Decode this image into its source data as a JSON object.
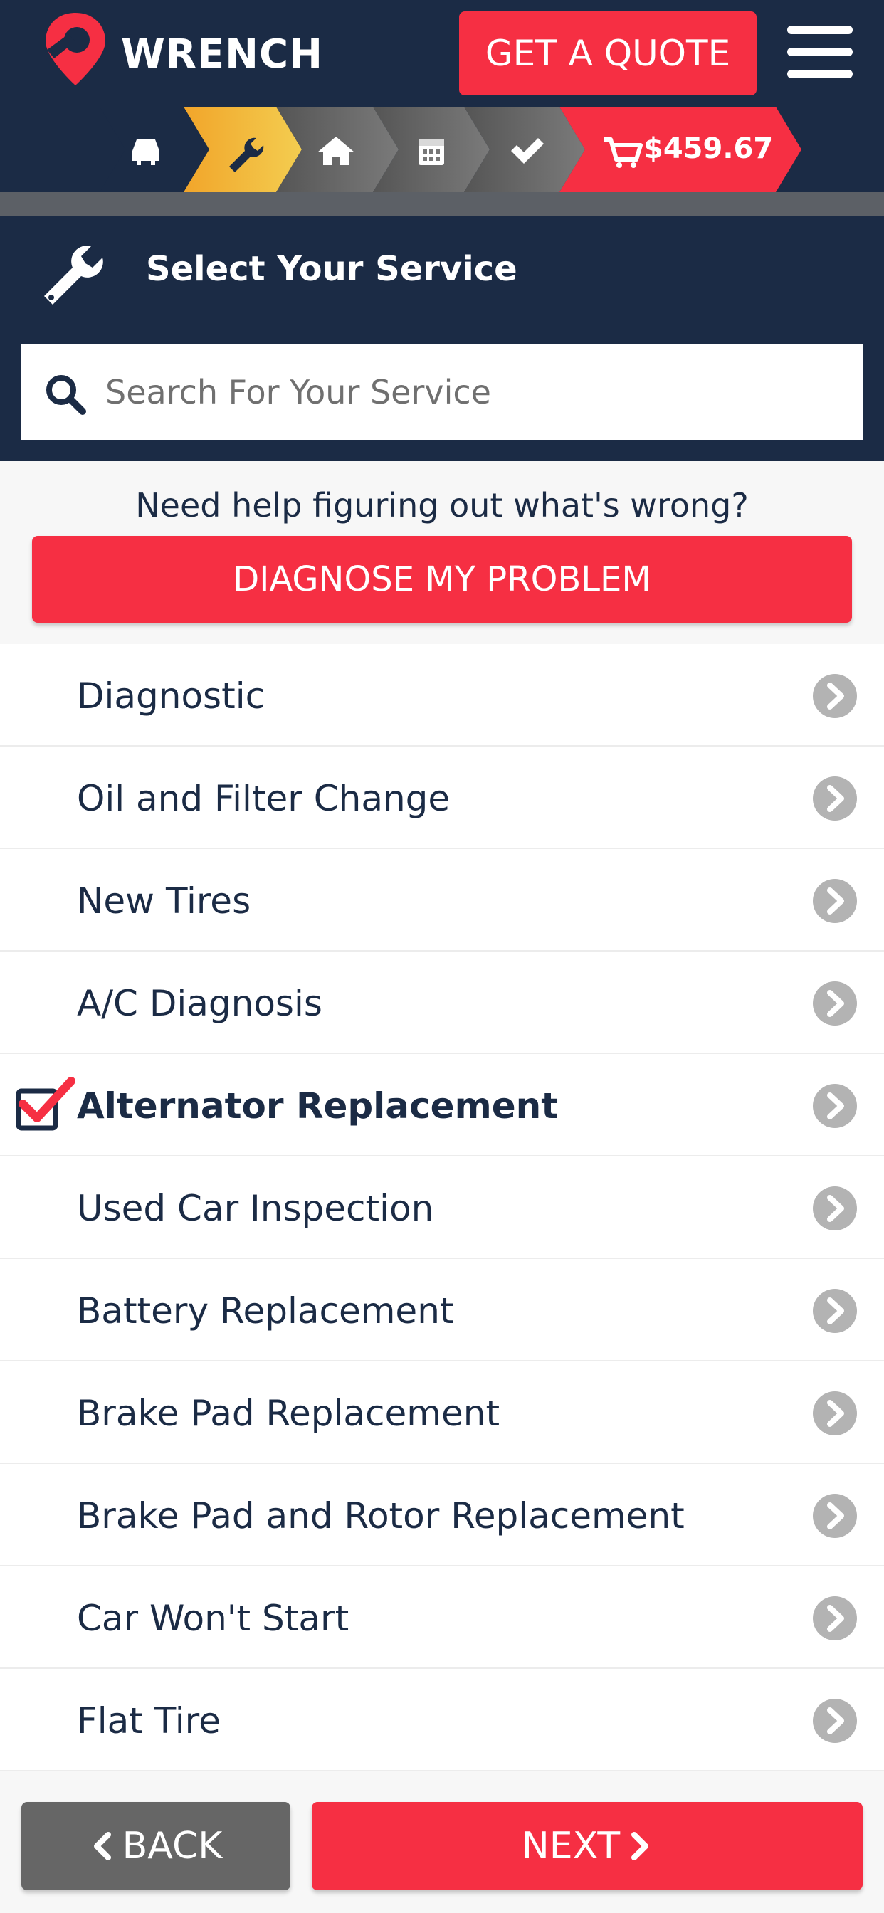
{
  "header": {
    "brand": "WRENCH",
    "quote_label": "GET A QUOTE",
    "logo_icon": "wrench-pin-logo-icon",
    "menu_icon": "hamburger-menu-icon"
  },
  "progress": {
    "steps": [
      {
        "icon": "car-icon",
        "state": "complete"
      },
      {
        "icon": "wrench-icon",
        "state": "active"
      },
      {
        "icon": "home-icon",
        "state": "pending"
      },
      {
        "icon": "calendar-icon",
        "state": "pending"
      },
      {
        "icon": "check-icon",
        "state": "pending"
      }
    ],
    "cart_total": "$459.67",
    "cart_icon": "cart-icon"
  },
  "service_panel": {
    "title": "Select Your Service",
    "search_placeholder": "Search For Your Service"
  },
  "help": {
    "prompt": "Need help figuring out what's wrong?",
    "diagnose_label": "DIAGNOSE MY PROBLEM"
  },
  "services": [
    {
      "label": "Diagnostic",
      "selected": false
    },
    {
      "label": "Oil and Filter Change",
      "selected": false
    },
    {
      "label": "New Tires",
      "selected": false
    },
    {
      "label": "A/C Diagnosis",
      "selected": false
    },
    {
      "label": "Alternator Replacement",
      "selected": true
    },
    {
      "label": "Used Car Inspection",
      "selected": false
    },
    {
      "label": "Battery Replacement",
      "selected": false
    },
    {
      "label": "Brake Pad Replacement",
      "selected": false
    },
    {
      "label": "Brake Pad and Rotor Replacement",
      "selected": false
    },
    {
      "label": "Car Won't Start",
      "selected": false
    },
    {
      "label": "Flat Tire",
      "selected": false
    }
  ],
  "footer": {
    "back_label": "BACK",
    "next_label": "NEXT"
  },
  "colors": {
    "navy": "#1b2b45",
    "accent_red": "#f62f43",
    "gold": "#f3c544",
    "gray": "#666666"
  }
}
